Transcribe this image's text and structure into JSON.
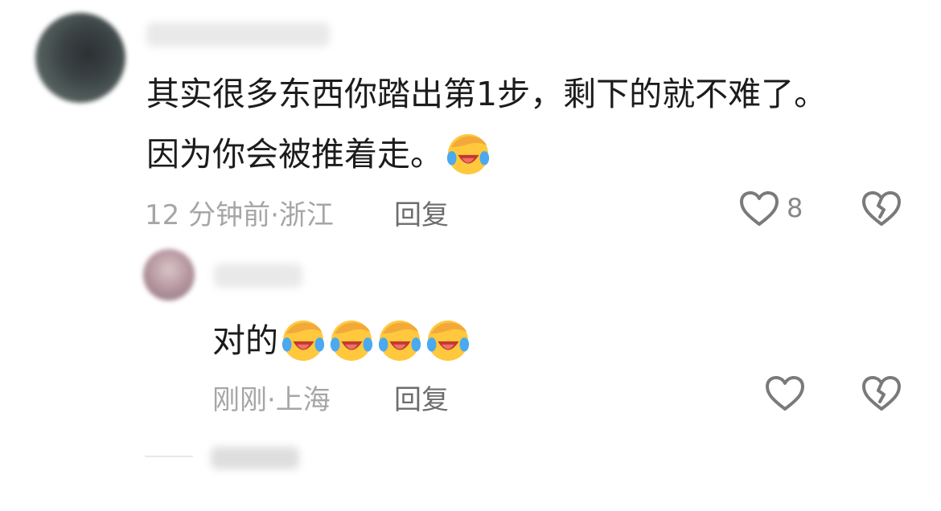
{
  "comment": {
    "text_line1": "其实很多东西你踏出第1步，剩下的就不难了。",
    "text_line2": "因为你会被推着走。",
    "time": "12 分钟前",
    "location": "·浙江",
    "reply_label": "回复",
    "like_count": "8",
    "emoji": "face-palm-crying-laughing-icon"
  },
  "reply": {
    "text": "对的",
    "emoji_count": 4,
    "time": "刚刚",
    "location": "·上海",
    "reply_label": "回复"
  },
  "colors": {
    "text": "#1c1c1c",
    "meta": "#a6a6a6",
    "reply_button": "#6d6d6d",
    "icon_stroke": "#7a7a7a"
  }
}
